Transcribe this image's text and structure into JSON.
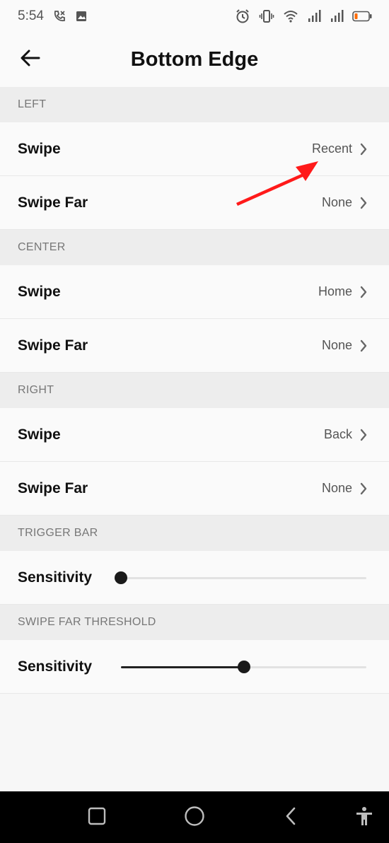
{
  "status_bar": {
    "time": "5:54",
    "left_icons": [
      "missed-call-icon",
      "image-icon"
    ],
    "right_icons": [
      "alarm-icon",
      "vibrate-icon",
      "wifi-icon",
      "signal-icon",
      "signal-icon",
      "battery-low-icon"
    ],
    "battery_color": "#ff6a00"
  },
  "header": {
    "title": "Bottom Edge",
    "back_icon": "arrow-left-icon"
  },
  "sections": {
    "left": {
      "header": "LEFT",
      "swipe": {
        "label": "Swipe",
        "value": "Recent"
      },
      "swipe_far": {
        "label": "Swipe Far",
        "value": "None"
      }
    },
    "center": {
      "header": "CENTER",
      "swipe": {
        "label": "Swipe",
        "value": "Home"
      },
      "swipe_far": {
        "label": "Swipe Far",
        "value": "None"
      }
    },
    "right": {
      "header": "RIGHT",
      "swipe": {
        "label": "Swipe",
        "value": "Back"
      },
      "swipe_far": {
        "label": "Swipe Far",
        "value": "None"
      }
    },
    "trigger_bar": {
      "header": "TRIGGER BAR",
      "sensitivity": {
        "label": "Sensitivity",
        "level": 0.0
      }
    },
    "swipe_far_threshold": {
      "header": "SWIPE FAR THRESHOLD",
      "sensitivity": {
        "label": "Sensitivity",
        "level": 0.5
      }
    }
  },
  "annotation": {
    "type": "red-arrow-icon",
    "color": "#ff1a1a"
  },
  "nav_bar": {
    "buttons": [
      "recents-square-icon",
      "home-circle-icon",
      "back-triangle-icon",
      "accessibility-icon"
    ]
  }
}
